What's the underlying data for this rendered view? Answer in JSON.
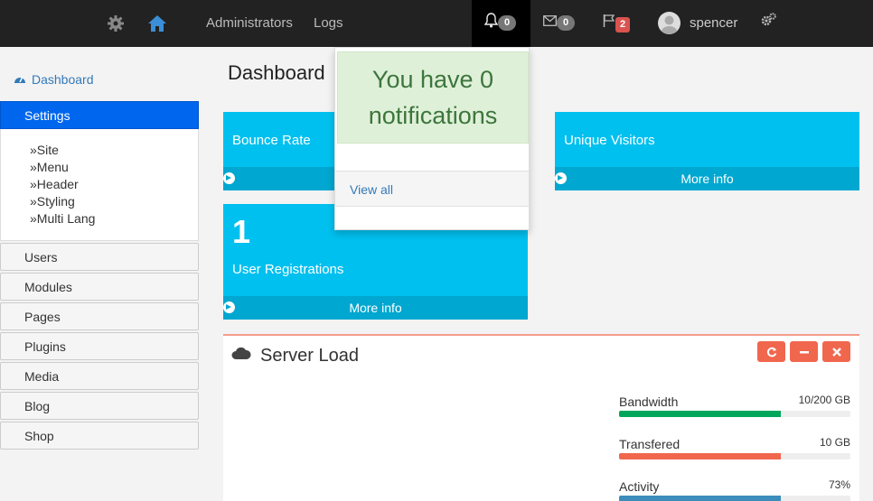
{
  "topnav": {
    "links": [
      "Administrators",
      "Logs"
    ],
    "notifications_count": "0",
    "messages_count": "0",
    "flags_count": "2",
    "user_name": "spencer"
  },
  "sidebar": {
    "dashboard_label": "Dashboard",
    "settings_label": "Settings",
    "settings_subitems": [
      "Site",
      "Menu",
      "Header",
      "Styling",
      "Multi Lang"
    ],
    "items": [
      "Users",
      "Modules",
      "Pages",
      "Plugins",
      "Media",
      "Blog",
      "Shop"
    ]
  },
  "main": {
    "title": "Dashboard",
    "tiles": {
      "bounce_label": "Bounce Rate",
      "visitors_label": "Unique Visitors",
      "visitors_footer": "More info",
      "registrations_count": "1",
      "registrations_label": "User Registrations",
      "registrations_footer": "More info"
    }
  },
  "notification_dropdown": {
    "message": "You have 0 notifications",
    "view_all": "View all"
  },
  "server_load": {
    "title": "Server Load",
    "meters": [
      {
        "label": "Bandwidth",
        "value": "10/200 GB",
        "fill": 0.7,
        "color": "#00a65a"
      },
      {
        "label": "Transfered",
        "value": "10 GB",
        "fill": 0.7,
        "color": "#f0674d"
      },
      {
        "label": "Activity",
        "value": "73%",
        "fill": 0.7,
        "color": "#3c8dbc"
      }
    ]
  },
  "colors": {
    "accent_blue": "#0066ee",
    "tile_cyan": "#00c0ef",
    "tile_footer": "#00a7d0",
    "danger": "#f0674d",
    "alert_green_bg": "#dff0d8",
    "alert_green_text": "#3c763d"
  }
}
